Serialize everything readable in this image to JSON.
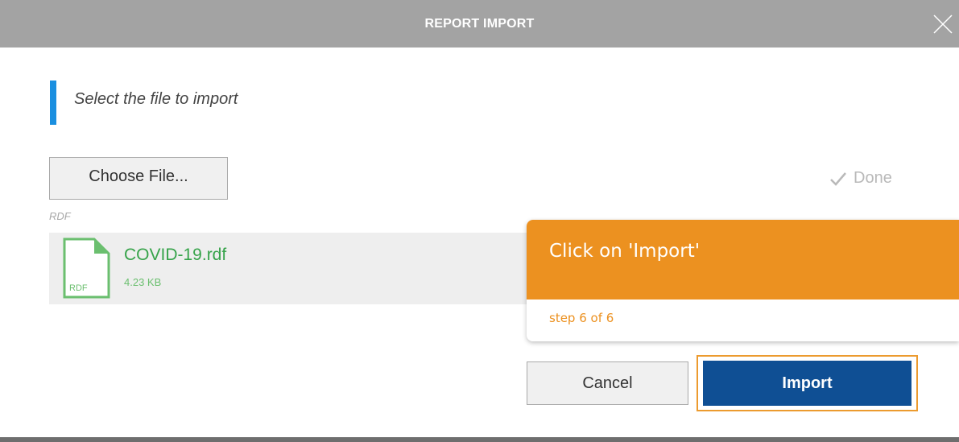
{
  "dialog": {
    "title": "REPORT IMPORT",
    "close_icon": "close-icon"
  },
  "instruction": {
    "text": "Select the file to import"
  },
  "file_picker": {
    "choose_label": "Choose File...",
    "done_label": "Done",
    "done_icon": "checkmark-icon",
    "file_type_label": "RDF"
  },
  "file": {
    "icon": "rdf-file-icon",
    "icon_text": "RDF",
    "name": "COVID-19.rdf",
    "size": "4.23 KB"
  },
  "actions": {
    "cancel_label": "Cancel",
    "import_label": "Import"
  },
  "tour_tooltip": {
    "message": "Click on 'Import'",
    "step": "step 6 of 6"
  },
  "colors": {
    "title_bar": "#a3a3a3",
    "accent_bar": "#1a8fe0",
    "import_button": "#0f4f94",
    "tooltip_orange": "#ec9120",
    "file_green": "#36a34a"
  }
}
